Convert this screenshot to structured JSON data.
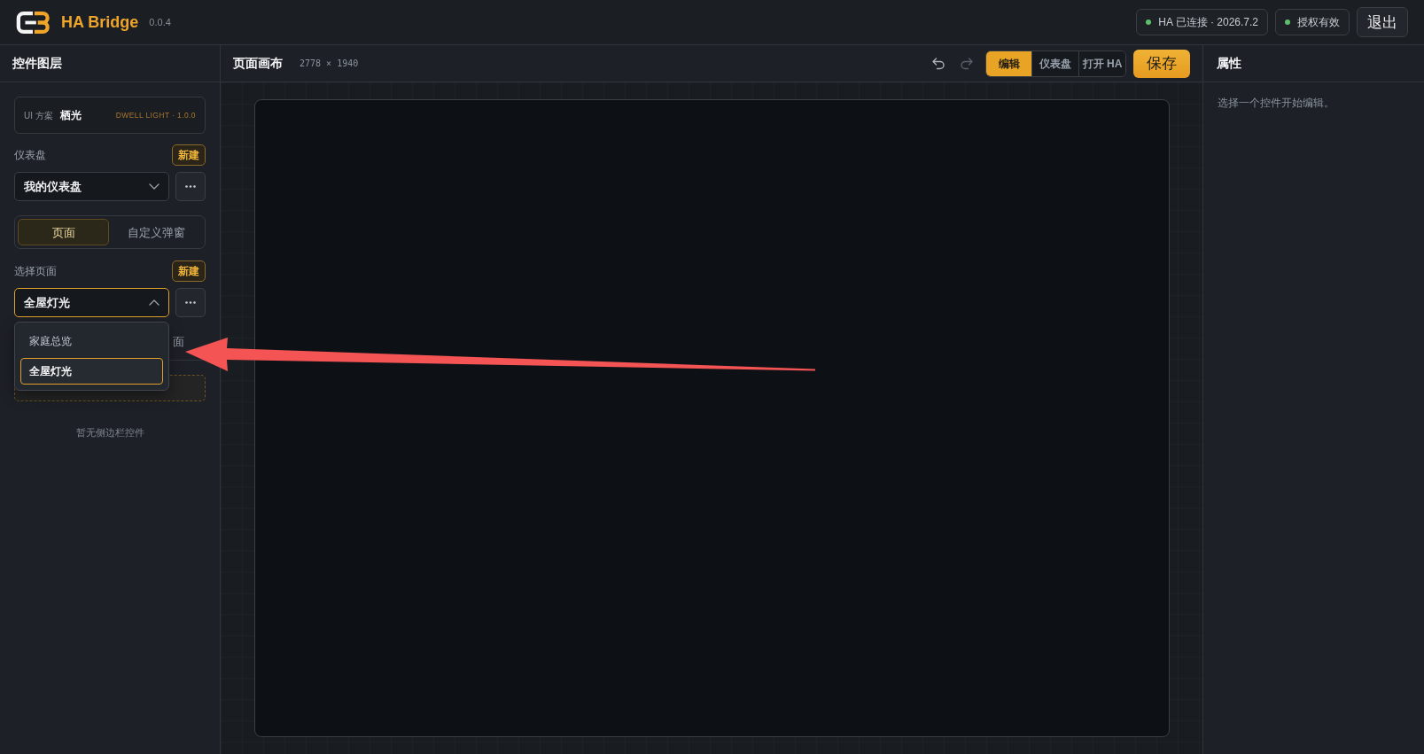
{
  "header": {
    "app_name": "HA Bridge",
    "version": "0.0.4",
    "status_badges": [
      {
        "label": "HA 已连接 · 2026.7.2",
        "color": "#5cbf6b"
      },
      {
        "label": "授权有效",
        "color": "#5cbf6b"
      }
    ],
    "logout_button": "退出"
  },
  "layers_panel": {
    "title": "控件图层",
    "ui_scheme": {
      "label": "UI 方案",
      "name": "栖光",
      "version": "DWELL LIGHT · 1.0.0"
    },
    "dashboard": {
      "label": "仪表盘",
      "new_button": "新建",
      "select": {
        "value": "我的仪表盘",
        "expanded": false
      }
    },
    "mode_tabs": [
      {
        "label": "页面",
        "selected": true
      },
      {
        "label": "自定义弹窗",
        "selected": false
      }
    ],
    "page": {
      "label": "选择页面",
      "new_button": "新建",
      "select": {
        "value": "全屋灯光",
        "expanded": true
      },
      "options": [
        {
          "label": "家庭总览",
          "selected": false
        },
        {
          "label": "全屋灯光",
          "selected": true
        }
      ]
    },
    "partial_text": "面",
    "empty_message": "暂无侧边栏控件"
  },
  "canvas": {
    "title": "页面画布",
    "size": "2778 × 1940",
    "undo": {
      "disabled": false
    },
    "redo": {
      "disabled": true
    },
    "view_tabs": [
      {
        "label": "编辑",
        "selected": true
      },
      {
        "label": "仪表盘",
        "selected": false
      },
      {
        "label": "打开 HA",
        "selected": false
      }
    ],
    "save_button": "保存"
  },
  "properties_panel": {
    "title": "属性",
    "hint": "选择一个控件开始编辑。"
  },
  "annotations": [
    {
      "kind": "arrow"
    }
  ]
}
